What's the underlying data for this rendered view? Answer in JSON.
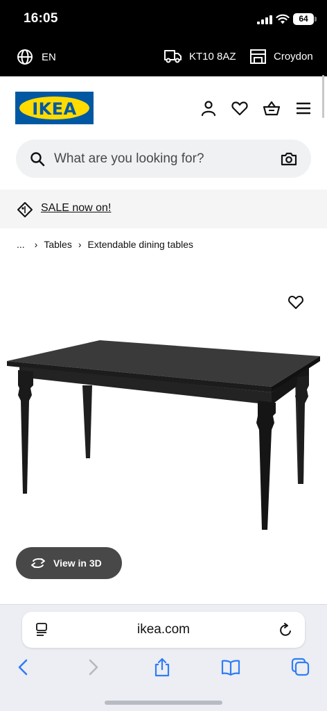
{
  "status_bar": {
    "time": "16:05",
    "battery_level": "64"
  },
  "util_bar": {
    "language": "EN",
    "postcode": "KT10 8AZ",
    "store": "Croydon"
  },
  "header": {
    "logo_text": "IKEA"
  },
  "search": {
    "placeholder": "What are you looking for?"
  },
  "promo": {
    "sale_text": "SALE now on!"
  },
  "breadcrumb": {
    "ellipsis": "...",
    "items": [
      "Tables",
      "Extendable dining tables"
    ]
  },
  "product": {
    "view_3d_label": "View in 3D"
  },
  "browser": {
    "domain": "ikea.com"
  },
  "colors": {
    "brand_blue": "#0058a3",
    "brand_yellow": "#ffdb00",
    "ios_blue": "#2f7cf6"
  }
}
